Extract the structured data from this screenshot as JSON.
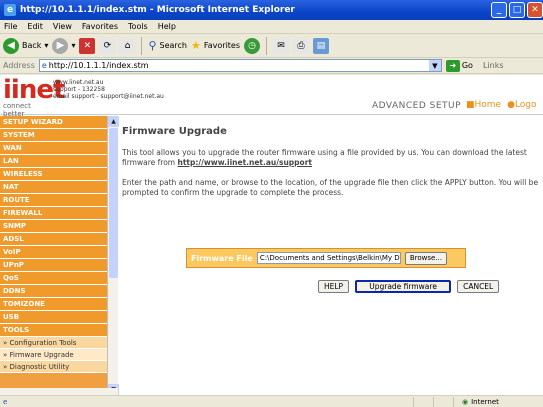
{
  "window": {
    "title": "http://10.1.1.1/index.stm - Microsoft Internet Explorer"
  },
  "menu": [
    "File",
    "Edit",
    "View",
    "Favorites",
    "Tools",
    "Help"
  ],
  "toolbar": {
    "back": "Back",
    "search": "Search",
    "favorites": "Favorites"
  },
  "address": {
    "label": "Address",
    "url": "http://10.1.1.1/index.stm",
    "go": "Go",
    "links": "Links"
  },
  "header": {
    "logo_text": "iinet",
    "logo_tagline": "connect better",
    "contact_line1": "www.iinet.net.au",
    "contact_line2": "support - 132258",
    "contact_line3": "email support - support@iinet.net.au",
    "section": "ADVANCED SETUP",
    "home": "■Home",
    "logout": "●Logo"
  },
  "sidebar": {
    "items": [
      "SETUP WIZARD",
      "SYSTEM",
      "WAN",
      "LAN",
      "WIRELESS",
      "NAT",
      "ROUTE",
      "FIREWALL",
      "SNMP",
      "ADSL",
      "VoIP",
      "UPnP",
      "QoS",
      "DDNS",
      "TOMIZONE",
      "USB",
      "TOOLS"
    ],
    "subitems": [
      "» Configuration Tools",
      "» Firmware Upgrade",
      "» Diagnostic Utility"
    ]
  },
  "main": {
    "title": "Firmware Upgrade",
    "para1": "This tool allows you to upgrade the router firmware using a file provided by us. You can download the latest firmware from",
    "link": "http://www.iinet.net.au/support",
    "para2": "Enter the path and name, or browse to the location, of the upgrade file then click the APPLY button. You will be prompted to confirm the upgrade to complete the process.",
    "file_label": "Firmware File",
    "file_value": "C:\\Documents and Settings\\Belkin\\My Documents\\",
    "browse": "Browse...",
    "help": "HELP",
    "upgrade": "Upgrade firmware",
    "cancel": "CANCEL"
  },
  "status": {
    "zone": "Internet"
  }
}
